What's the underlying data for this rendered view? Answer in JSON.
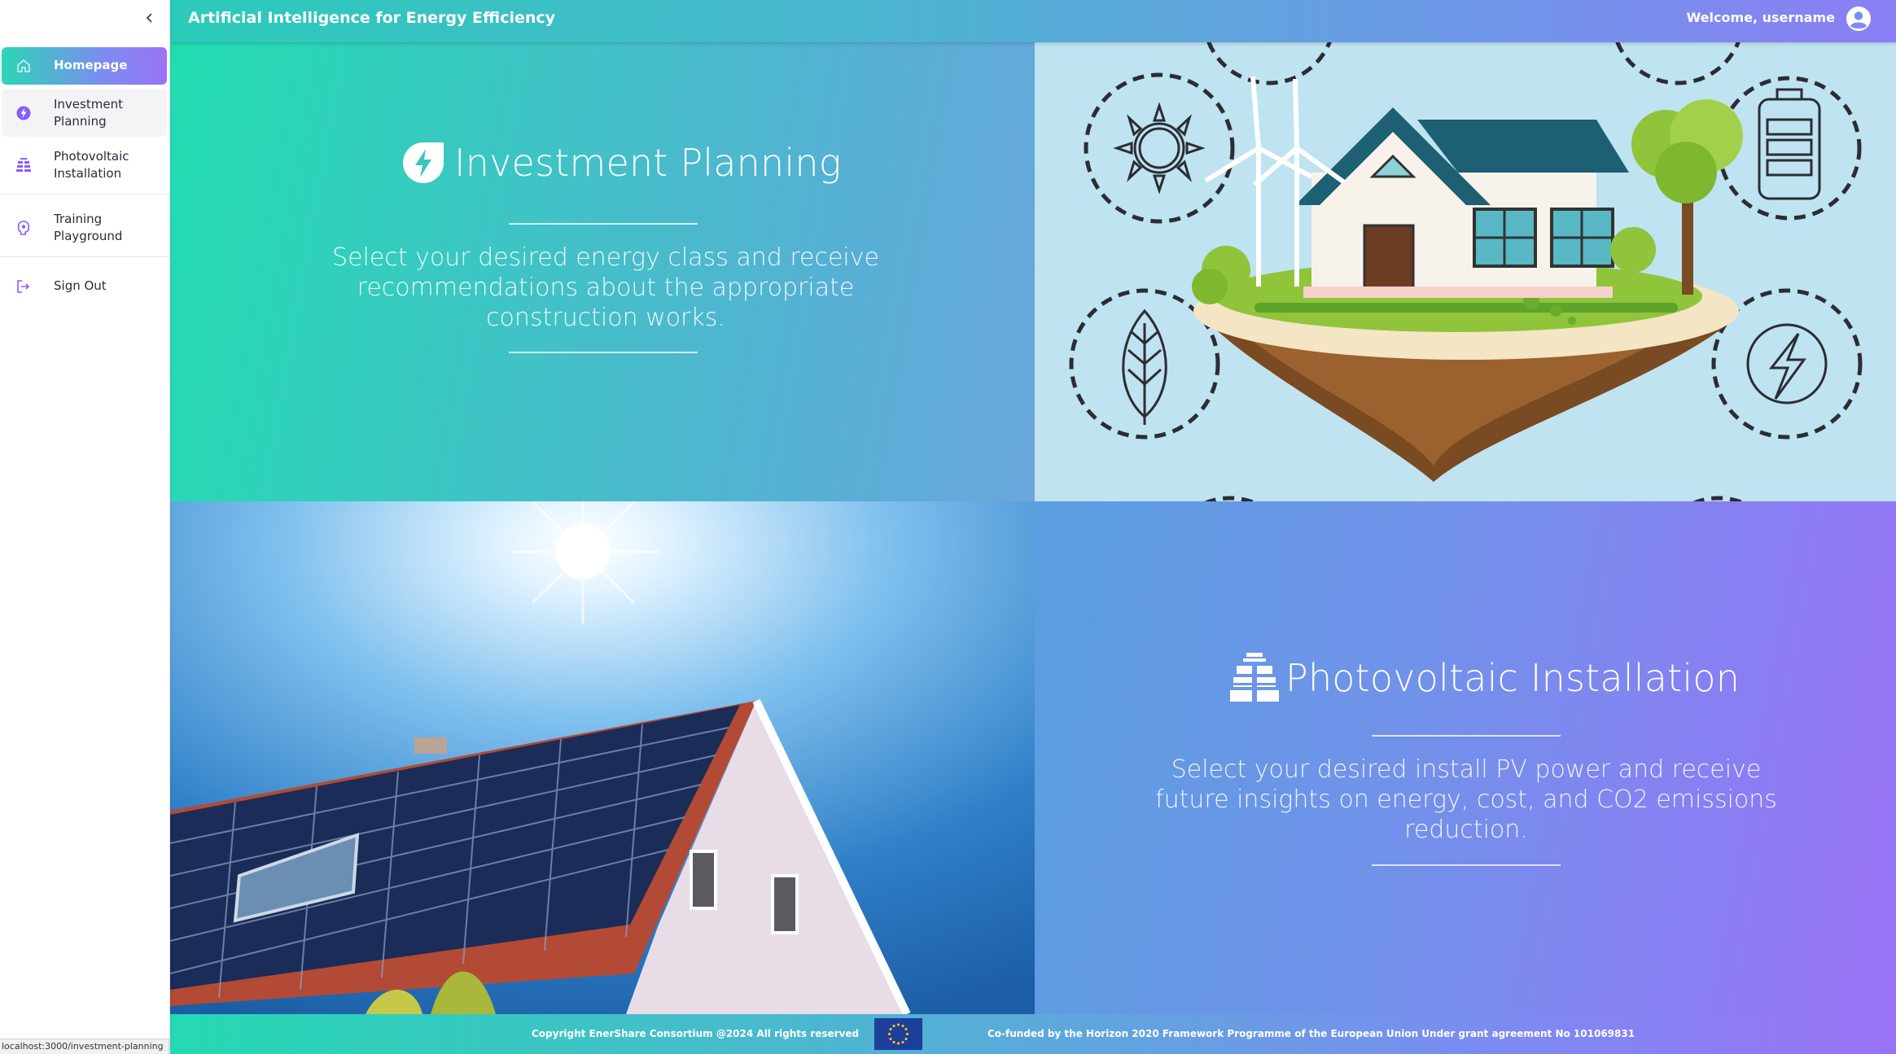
{
  "header": {
    "title": "Artificial Intelligence for Energy Efficiency",
    "welcome": "Welcome, username"
  },
  "sidebar": {
    "items": [
      {
        "label": "Homepage",
        "icon": "home-icon",
        "active": true
      },
      {
        "label_line1": "Investment",
        "label_line2": "Planning",
        "icon": "bolt-icon"
      },
      {
        "label_line1": "Photovoltaic",
        "label_line2": "Installation",
        "icon": "solar-panel-icon"
      },
      {
        "label_line1": "Training",
        "label_line2": "Playground",
        "icon": "brain-icon"
      },
      {
        "label": "Sign Out",
        "icon": "sign-out-icon"
      }
    ]
  },
  "cards": {
    "investment": {
      "title": "Investment Planning",
      "description": "Select your desired energy class and receive recommendations about the appropriate construction works."
    },
    "photovoltaic": {
      "title": "Photovoltaic Installation",
      "description": "Select your desired install PV power and receive future insights on energy, cost, and CO2 emissions reduction."
    }
  },
  "footer": {
    "copyright": "Copyright EnerShare Consortium @2024 All rights reserved",
    "cofunded": "Co-funded by the Horizon 2020 Framework Programme of the European Union Under grant agreement No 101069831"
  },
  "status_bar": {
    "url": "localhost:3000/investment-planning"
  },
  "colors": {
    "accent_teal": "#22ddb0",
    "accent_purple": "#9a72f6",
    "sidebar_icon": "#8a5cf6"
  }
}
